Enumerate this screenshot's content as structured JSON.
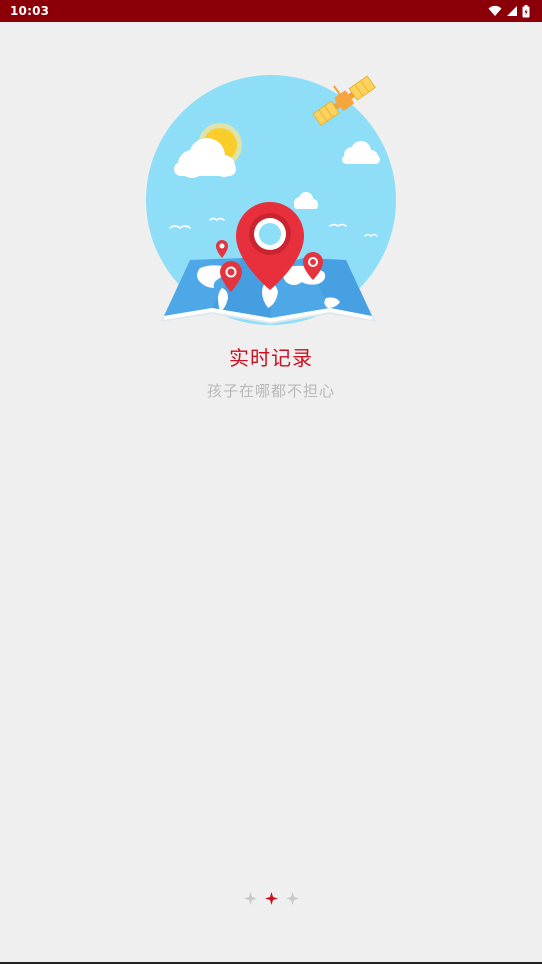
{
  "status_bar": {
    "time": "10:03",
    "icons": [
      "wifi-icon",
      "cell-signal-icon",
      "battery-icon"
    ],
    "background": "#8b0008"
  },
  "onboarding": {
    "title": "实时记录",
    "subtitle": "孩子在哪都不担心",
    "title_color": "#cc1020",
    "subtitle_color": "#b8b8b8"
  },
  "pager": {
    "page_count": 3,
    "active_index": 1,
    "active_color": "#cc1020",
    "inactive_color": "#c8c8c8"
  },
  "illustration": {
    "name": "map-location-illustration",
    "elements": [
      "sun",
      "clouds",
      "satellite",
      "map",
      "location-pins",
      "birds"
    ]
  }
}
